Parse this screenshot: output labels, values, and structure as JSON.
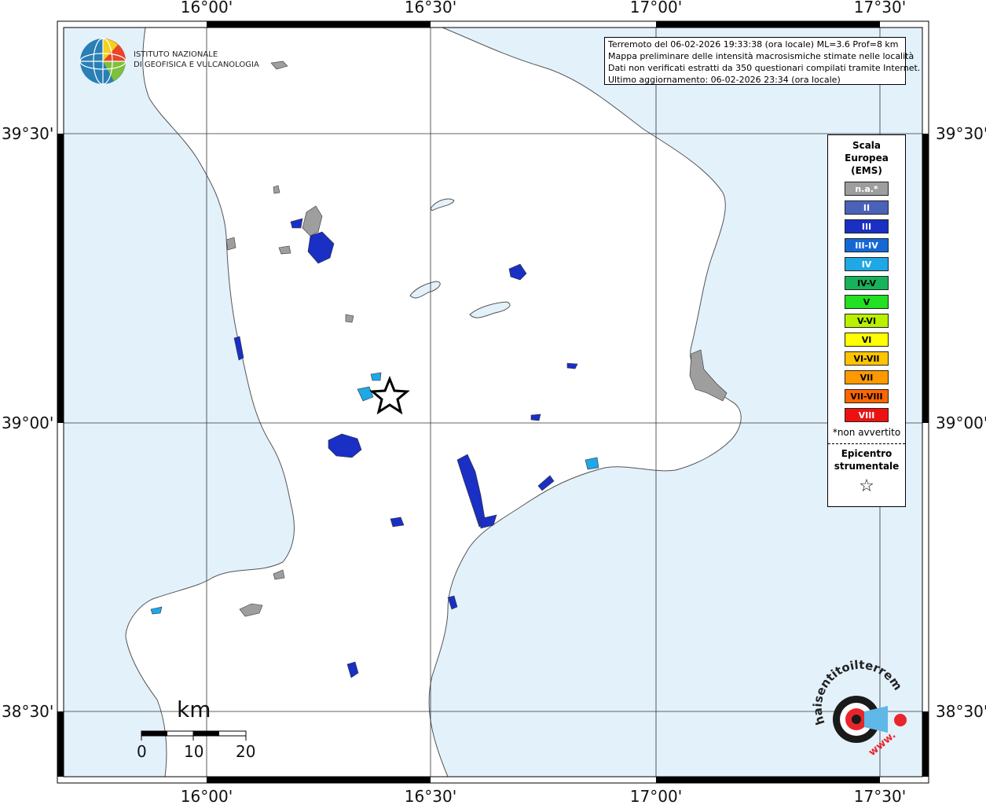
{
  "map": {
    "longitude_ticks": [
      "16°00'",
      "16°30'",
      "17°00'",
      "17°30'"
    ],
    "latitude_ticks": [
      "39°30'",
      "39°00'",
      "38°30'"
    ]
  },
  "logo": {
    "line1": "ISTITUTO NAZIONALE",
    "line2": "DI GEOFISICA E VULCANOLOGIA"
  },
  "info": {
    "line1": "Terremoto del 06-02-2026 19:33:38 (ora locale) ML=3.6 Prof=8 km",
    "line2": "Mappa preliminare delle intensità macrosismiche stimate nelle località",
    "line3": "Dati non verificati estratti da 350 questionari compilati tramite Internet.",
    "line4": "Ultimo aggiornamento: 06-02-2026 23:34 (ora locale)"
  },
  "legend": {
    "title1": "Scala",
    "title2": "Europea",
    "title3": "(EMS)",
    "classes": [
      {
        "label": "n.a.*",
        "color": "#9e9e9e"
      },
      {
        "label": "II",
        "color": "#4a63b8"
      },
      {
        "label": "III",
        "color": "#1a2fc4"
      },
      {
        "label": "III-IV",
        "color": "#1468d6"
      },
      {
        "label": "IV",
        "color": "#1fa7e6"
      },
      {
        "label": "IV-V",
        "color": "#17b35a"
      },
      {
        "label": "V",
        "color": "#22e022"
      },
      {
        "label": "V-VI",
        "color": "#b8f000"
      },
      {
        "label": "VI",
        "color": "#ffff00"
      },
      {
        "label": "VI-VII",
        "color": "#ffc400"
      },
      {
        "label": "VII",
        "color": "#ff9900"
      },
      {
        "label": "VII-VIII",
        "color": "#ff6600"
      },
      {
        "label": "VIII",
        "color": "#ee1111"
      }
    ],
    "note": "*non avvertito",
    "epicenter1": "Epicentro",
    "epicenter2": "strumentale",
    "star": "☆"
  },
  "scale_bar": {
    "unit": "km",
    "labels": [
      "0",
      "10",
      "20"
    ]
  },
  "brand": {
    "text": "haisentitoilterremoto.it",
    "www": "www."
  },
  "colors": {
    "sea": "#e3f1fb",
    "land": "#ffffff"
  }
}
